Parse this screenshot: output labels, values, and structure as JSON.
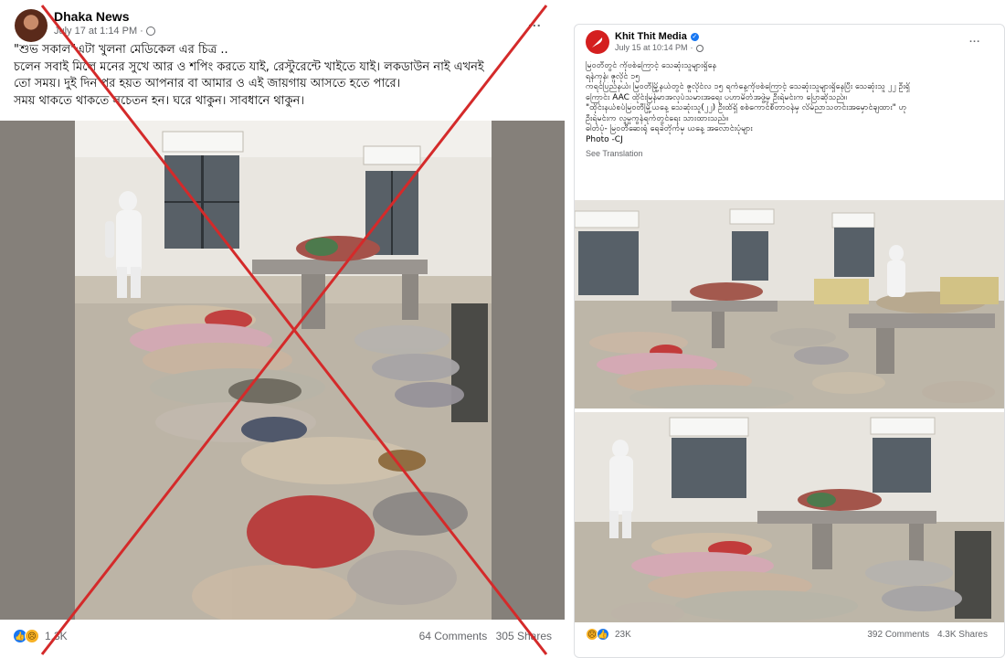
{
  "left_post": {
    "page_name": "Dhaka News",
    "timestamp": "July 17 at 1:14 PM",
    "visibility_icon": "globe-icon",
    "more_label": "...",
    "caption_lines": [
      "\"শুভ সকাল\"এটা খুলনা মেডিকেল এর চিত্র ..",
      "চলেন সবাই মিলে মনের সুখে আর ও শপিং করতে যাই, রেস্টুরেন্টে খাইতে যাই। লকডাউন নাই এখনই",
      "তো সময়। দুই দিন পর হয়ত আপনার বা আমার ও এই জায়গায় আসতে হতে পারে।",
      "সময় থাকতে থাকতে সচেতন হন। ঘরে থাকুন। সাবধানে থাকুন।"
    ],
    "reaction_count": "1.3K",
    "comments": "64 Comments",
    "shares": "305 Shares",
    "cross_color": "#d42a2a"
  },
  "right_post": {
    "page_name": "Khit Thit Media",
    "verified_icon": "verified-badge-icon",
    "timestamp": "July 15 at 10:14 PM",
    "visibility_icon": "globe-icon",
    "more_label": "...",
    "caption_lines": [
      "မြဝတီတွင် ကိုဗစ်ကြောင့် သေဆုံးသူများရှိနေ",
      "ရန်ကုန်၊ ဇူလိုင် ၁၅",
      "ကရင်ပြည်နယ်၊ မြဝတီမြို့နယ်တွင် ဇူလိုင်လ ၁၅ ရက်နေ့ကိုဗစ်ကြောင့် သေဆုံးသူများရှိနေပြီး သေဆုံးသူ ၂၂ ဦးရှိ",
      "ကြောင်း AAC ထိုင်းမြန်မာအလုပ်သမားအရေး ပဟာမိတ်အဖွဲ့မှ ဦးရဲမင်းက ပြောဆိုသည်။",
      "\"ထိုင်းနယ်စပ်မြဝတီမြို့ယနေ့ သေဆုံးသူ(၂၂) ဦးထိရှိ စစ်ကောင်စီတာဝန်မှ လိမ်ညာသတင်းအမှောင်ချထား\" ဟု",
      "ဦးရဲမင်းက လူမှုကွန်ရက်တွင်ရေး သားထားသည်။",
      "ဓါတ်ပုံ- မြဝတီဆေးရုံ ရေခဲတိုက်မှ ယနေ့ အလောင်းပုံများ",
      "Photo -CJ"
    ],
    "see_translation": "See Translation",
    "reaction_count": "23K",
    "comments": "392 Comments",
    "shares": "4.3K Shares",
    "accent": "#d41f1f"
  }
}
